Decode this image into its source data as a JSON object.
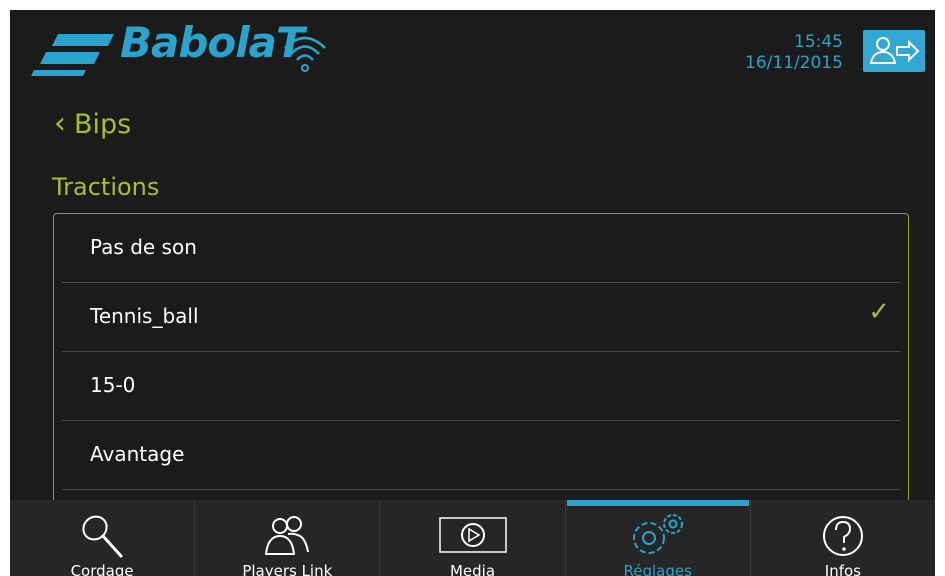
{
  "header": {
    "brand": "BabolaT",
    "time": "15:45",
    "date": "16/11/2015"
  },
  "back": {
    "label": "Bips"
  },
  "section": {
    "title": "Tractions"
  },
  "options": [
    {
      "label": "Pas de son",
      "selected": false
    },
    {
      "label": "Tennis_ball",
      "selected": true
    },
    {
      "label": "15-0",
      "selected": false
    },
    {
      "label": "Avantage",
      "selected": false
    }
  ],
  "check_glyph": "✓",
  "nav": {
    "tabs": [
      {
        "label": "Cordage",
        "icon": "racket-icon",
        "active": false
      },
      {
        "label": "Players Link",
        "icon": "players-icon",
        "active": false
      },
      {
        "label": "Media",
        "icon": "play-icon",
        "active": false
      },
      {
        "label": "Réglages",
        "icon": "gears-icon",
        "active": true
      },
      {
        "label": "Infos",
        "icon": "help-icon",
        "active": false
      }
    ]
  },
  "colors": {
    "accent_blue": "#2aa4cc",
    "accent_green": "#a9bf2e",
    "background": "#1b1b1b"
  }
}
